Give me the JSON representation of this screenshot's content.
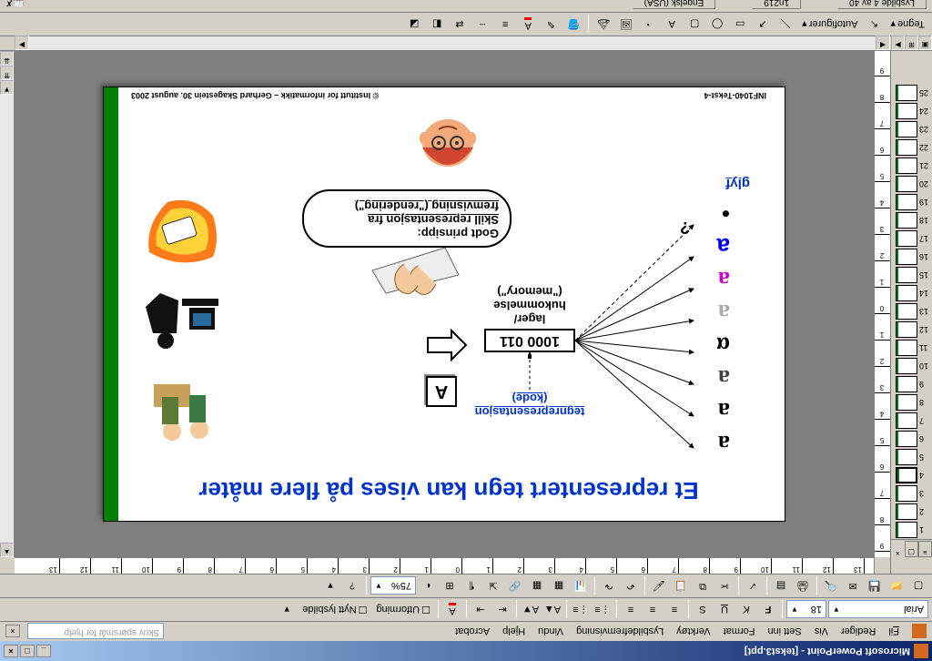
{
  "titlebar": {
    "title": "Microsoft PowerPoint - [tekst3.ppt]"
  },
  "menu": {
    "file": "Fil",
    "edit": "Rediger",
    "view": "Vis",
    "insert": "Sett inn",
    "format": "Format",
    "tools": "Verktøy",
    "slideshow": "Lysbildefremvisning",
    "window": "Vindu",
    "help": "Hjelp",
    "acrobat": "Acrobat",
    "help_placeholder": "Skriv spørsmål for hjelp"
  },
  "format_tb": {
    "font": "Arial",
    "size": "18",
    "design": "Utforming",
    "newslide": "Nytt lysbilde"
  },
  "standard_tb": {
    "zoom": "75%"
  },
  "ruler_h": [
    "13",
    "12",
    "11",
    "10",
    "9",
    "8",
    "7",
    "6",
    "5",
    "4",
    "3",
    "2",
    "1",
    "0",
    "1",
    "2",
    "3",
    "4",
    "5",
    "6",
    "7",
    "8",
    "9",
    "10",
    "11",
    "12",
    "13"
  ],
  "ruler_v": [
    "9",
    "8",
    "7",
    "6",
    "5",
    "4",
    "3",
    "2",
    "1",
    "0",
    "1",
    "2",
    "3",
    "4",
    "5",
    "6",
    "7",
    "8",
    "9"
  ],
  "slides": {
    "count": 25,
    "current": 4
  },
  "slide": {
    "title": "Et representert tegn kan vises på flere måter",
    "glyphs": [
      "a",
      "a",
      "a",
      "α",
      "a",
      "a",
      "a",
      "•"
    ],
    "glyph_colors": [
      "#000",
      "#000",
      "#444",
      "#000",
      "#aaa",
      "#c0c",
      "#00f",
      "#000"
    ],
    "dot_question": "?",
    "glyf_label": "glyf",
    "kode_label1": "tegnrepresentasjon",
    "kode_label2": "(kode)",
    "mem_value": "1000 011",
    "mem_label1": "lager/",
    "mem_label2": "hukommelse",
    "mem_label3": "(\"memory\")",
    "key": "A",
    "speech1": "Godt prinsipp:",
    "speech2": "Skill representasjon fra",
    "speech3": "fremvisning (\"rendering\")",
    "footer_left": "INF1040-Tekst-4",
    "footer_right": "© Institutt for informatikk – Gerhard Skagestein 30. august 2003"
  },
  "draw_tb": {
    "draw": "Tegne",
    "autoshapes": "Autofigurer"
  },
  "status": {
    "slide": "Lysbilde 4 av 40",
    "template": "1n219",
    "lang": "Engelsk (USA)"
  }
}
